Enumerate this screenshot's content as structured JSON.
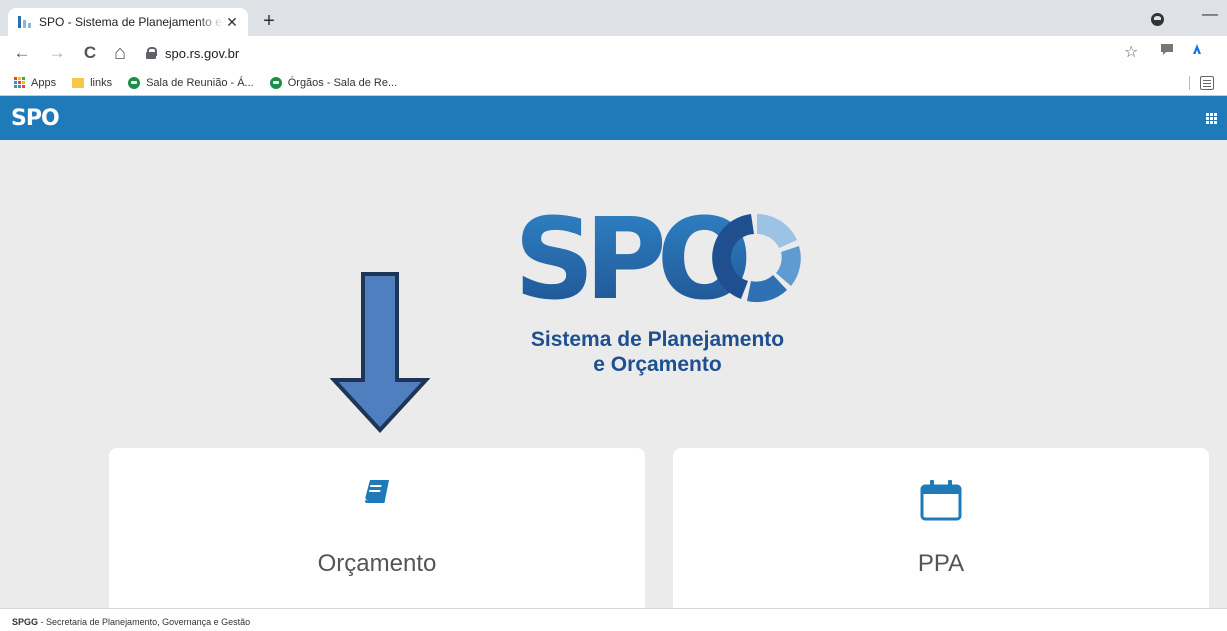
{
  "browser": {
    "tab_title": "SPO - Sistema de Planejamento e Orçamento",
    "close_glyph": "✕",
    "newtab_glyph": "+",
    "minimize_glyph": "—",
    "nav": {
      "back": "←",
      "forward": "→",
      "reload": "C",
      "home": "⌂"
    },
    "url": "spo.rs.gov.br",
    "star_glyph": "☆",
    "bookmarks": [
      {
        "label": "Apps"
      },
      {
        "label": "links"
      },
      {
        "label": "Sala de Reunião - Á..."
      },
      {
        "label": "Órgãos - Sala de Re..."
      }
    ]
  },
  "navbar": {
    "logo": "SPO"
  },
  "hero": {
    "logo_text": "SPO",
    "subtitle_line1": "Sistema de Planejamento",
    "subtitle_line2": "e Orçamento"
  },
  "cards": [
    {
      "label": "Orçamento",
      "icon": "book-icon"
    },
    {
      "label": "PPA",
      "icon": "calendar-icon"
    }
  ],
  "footer": {
    "org_abbr": "SPGG",
    "org_name": " - Secretaria de Planejamento, Governança e Gestão"
  },
  "colors": {
    "brand_blue": "#1e7ab8",
    "logo_dark": "#1e4f8f",
    "arrow_fill": "#4f7fbf",
    "arrow_stroke": "#1d3557"
  }
}
